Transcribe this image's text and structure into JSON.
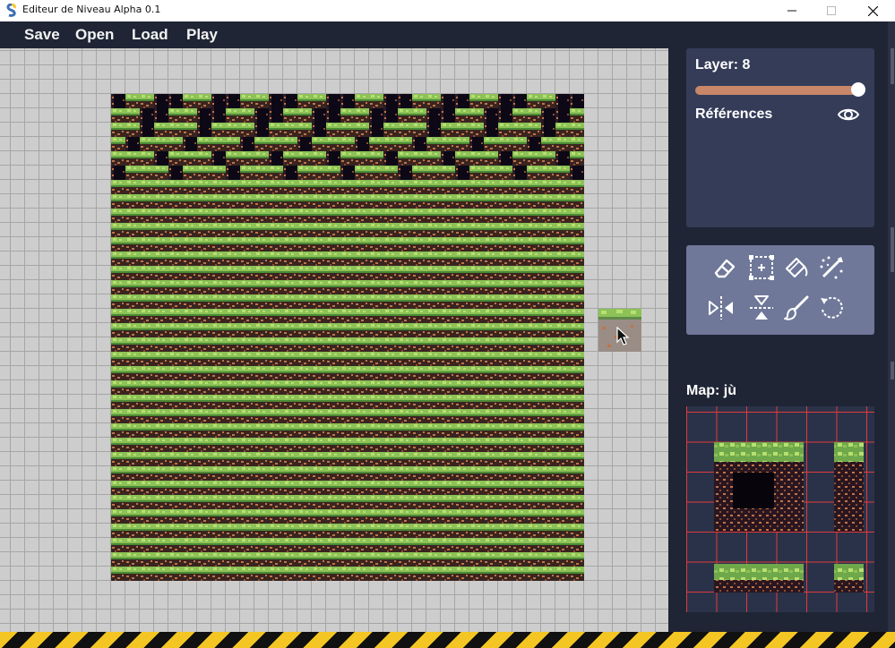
{
  "window": {
    "title": "Editeur de Niveau Alpha 0.1"
  },
  "menu": {
    "save": "Save",
    "open": "Open",
    "load": "Load",
    "play": "Play"
  },
  "layer_panel": {
    "label": "Layer: 8",
    "slider_value": 1.0,
    "references_label": "Références"
  },
  "tools": [
    "eraser-icon",
    "select-area-icon",
    "fill-bucket-icon",
    "random-brush-icon",
    "flip-horizontal-icon",
    "flip-vertical-icon",
    "brush-icon",
    "rotate-icon"
  ],
  "tileset": {
    "label": "Map: jù"
  },
  "colors": {
    "accent": "#c9876a",
    "panel": "#343c58",
    "toolbar": "#6f7899",
    "background": "#1f2535",
    "grid": "#e23a3a",
    "grass": "#8cc257",
    "dirt": "#c07447"
  }
}
